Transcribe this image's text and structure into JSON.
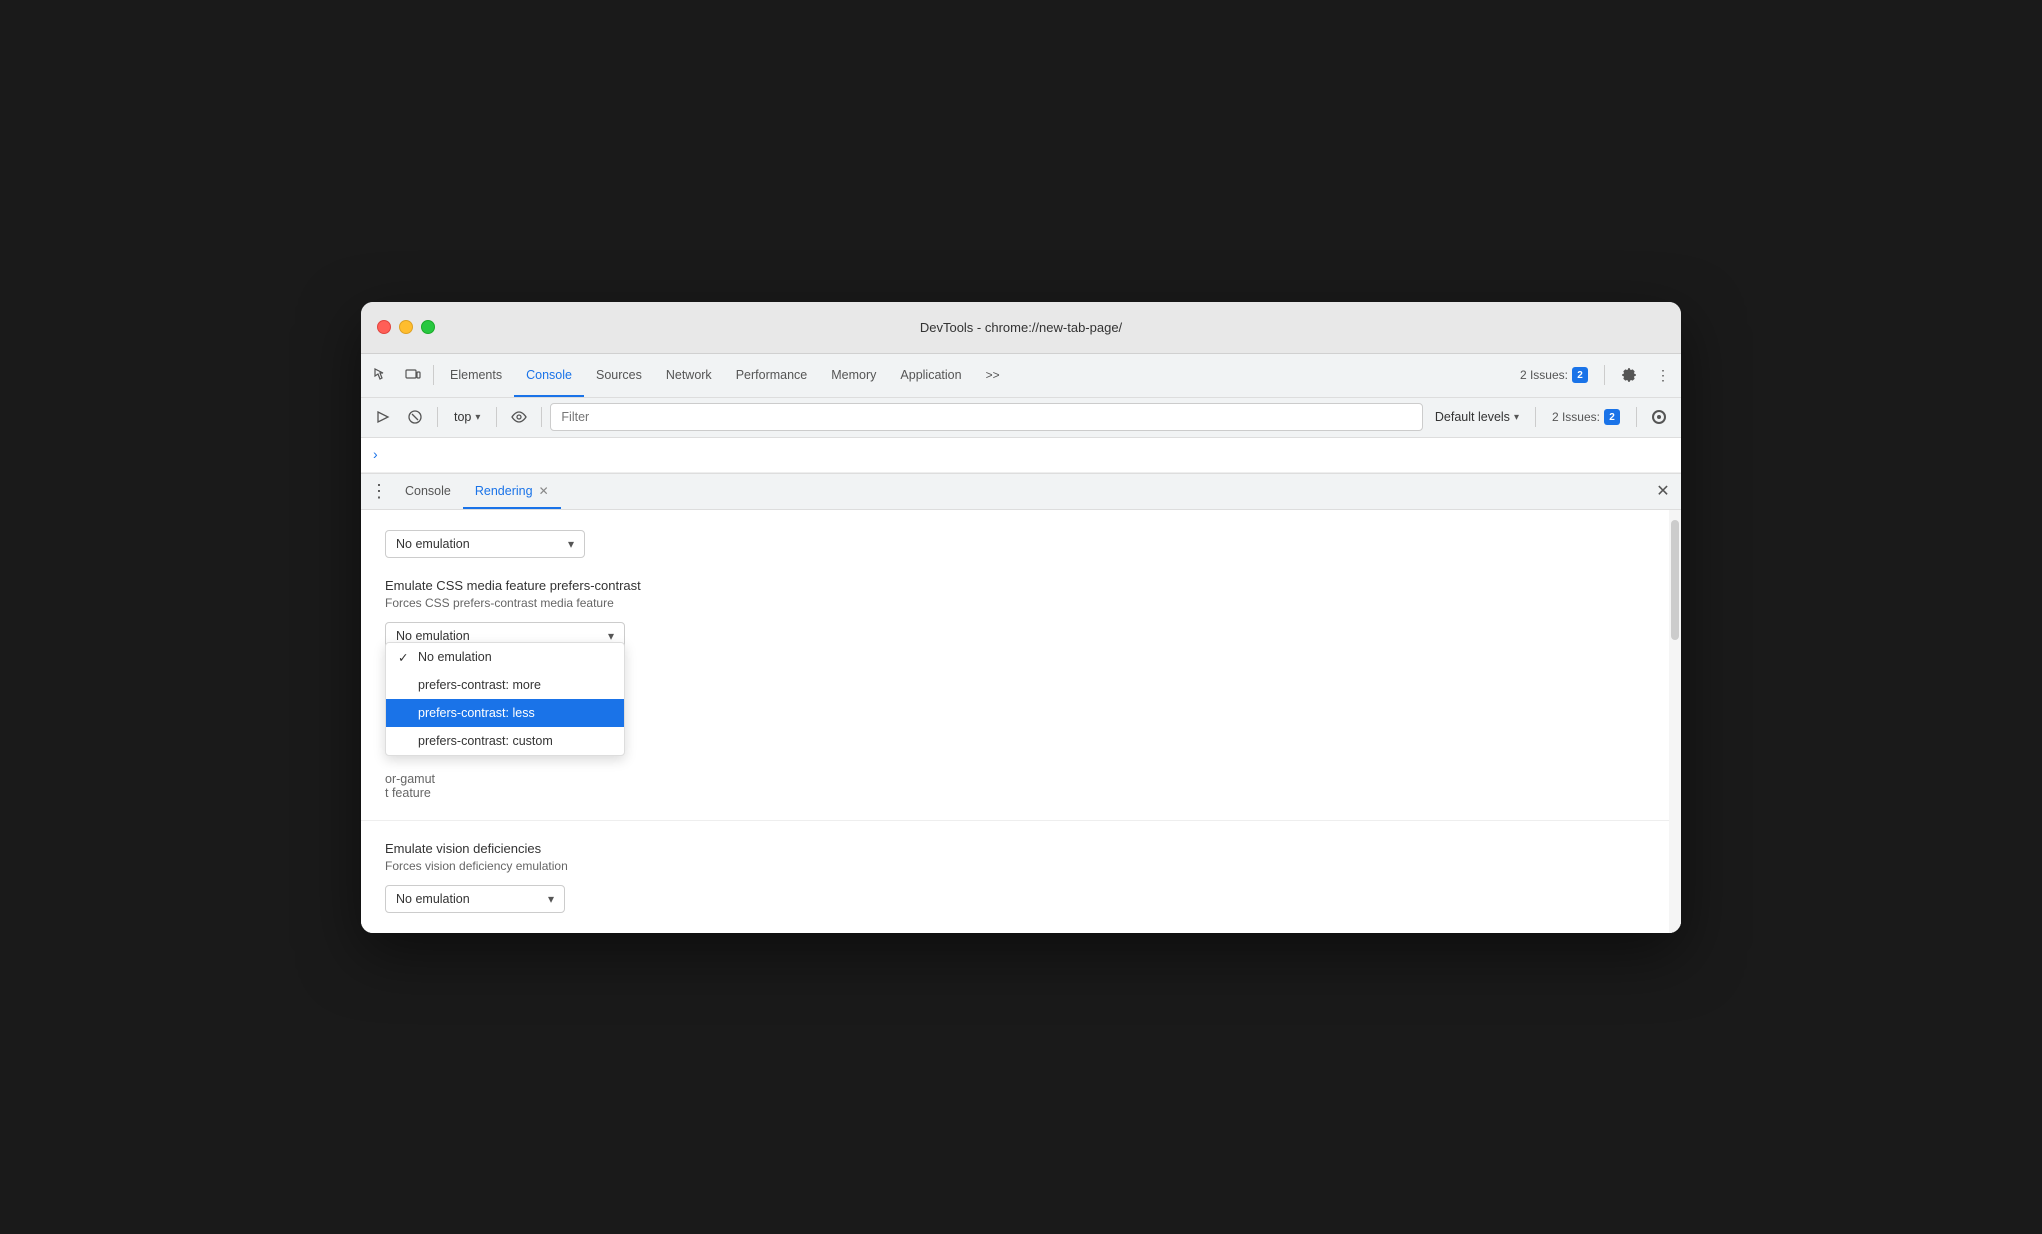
{
  "window": {
    "title": "DevTools - chrome://new-tab-page/",
    "traffic_lights": {
      "red": "close",
      "yellow": "minimize",
      "green": "maximize"
    }
  },
  "toolbar": {
    "inspect_icon": "cursor-icon",
    "device_icon": "device-icon",
    "tabs": [
      {
        "label": "Elements",
        "active": false
      },
      {
        "label": "Console",
        "active": true
      },
      {
        "label": "Sources",
        "active": false
      },
      {
        "label": "Network",
        "active": false
      },
      {
        "label": "Performance",
        "active": false
      },
      {
        "label": "Memory",
        "active": false
      },
      {
        "label": "Application",
        "active": false
      }
    ],
    "more_tabs_label": ">>",
    "issues_label": "2 Issues:",
    "issues_count": "2",
    "settings_icon": "gear-icon",
    "more_options_icon": "more-vertical-icon"
  },
  "console_toolbar": {
    "clear_icon": "block-icon",
    "execute_icon": "play-icon",
    "top_selector": "top",
    "eye_icon": "eye-icon",
    "filter_placeholder": "Filter",
    "default_levels_label": "Default levels",
    "issues_label": "2 Issues:",
    "issues_count": "2",
    "settings_icon": "settings-icon"
  },
  "console_area": {
    "prompt_char": ">"
  },
  "panel": {
    "tabs": [
      {
        "label": "Console",
        "active": false,
        "closeable": false
      },
      {
        "label": "Rendering",
        "active": true,
        "closeable": true
      }
    ],
    "menu_icon": "three-dots-icon",
    "close_icon": "close-icon"
  },
  "rendering": {
    "section_top_dropdown": {
      "value": "No emulation",
      "label": "No emulation"
    },
    "prefers_contrast": {
      "label": "Emulate CSS media feature prefers-contrast",
      "description": "Forces CSS prefers-contrast media feature",
      "selected_value": "No emulation",
      "dropdown_open": true,
      "options": [
        {
          "label": "No emulation",
          "checked": true,
          "highlighted": false
        },
        {
          "label": "prefers-contrast: more",
          "checked": false,
          "highlighted": false
        },
        {
          "label": "prefers-contrast: less",
          "checked": false,
          "highlighted": true
        },
        {
          "label": "prefers-contrast: custom",
          "checked": false,
          "highlighted": false
        }
      ]
    },
    "color_gamut": {
      "truncated_label": "or-gamut",
      "truncated_desc": "t feature"
    },
    "vision_deficiencies": {
      "label": "Emulate vision deficiencies",
      "description": "Forces vision deficiency emulation",
      "selected_value": "No emulation"
    }
  }
}
